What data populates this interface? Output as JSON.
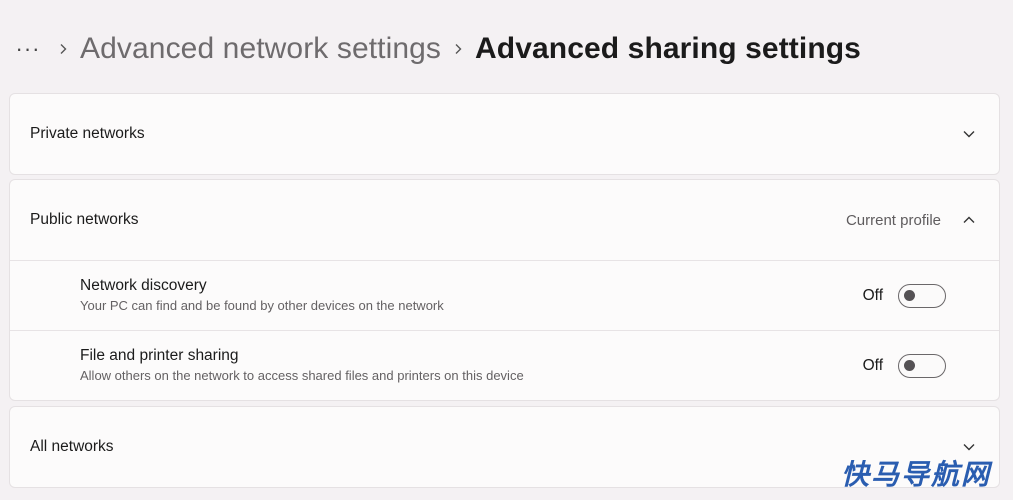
{
  "breadcrumb": {
    "more": "···",
    "parent": "Advanced network settings",
    "current": "Advanced sharing settings"
  },
  "private_networks": {
    "title": "Private networks"
  },
  "public_networks": {
    "title": "Public networks",
    "profile_label": "Current profile",
    "settings": [
      {
        "title": "Network discovery",
        "description": "Your PC can find and be found by other devices on the network",
        "state": "Off"
      },
      {
        "title": "File and printer sharing",
        "description": "Allow others on the network to access shared files and printers on this device",
        "state": "Off"
      }
    ]
  },
  "all_networks": {
    "title": "All networks"
  },
  "watermark": "快马导航网"
}
